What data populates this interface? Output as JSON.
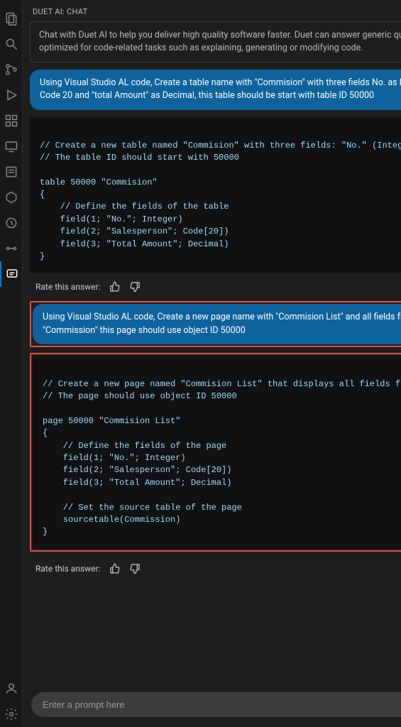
{
  "header": {
    "title": "DUET AI: CHAT"
  },
  "intro": "Chat with Duet AI to help you deliver high quality software faster. Duet can answer generic questions, but it's optimized for code-related tasks such as explaining, generating or modifying code.",
  "messages": {
    "user1": "Using Visual Studio AL code, Create a table name with \"Commision\" with three fields No. as Integer, Salesperson as Code 20 and \"total Amount\" as Decimal, this table should be start with table ID 50000",
    "code1": "// Create a new table named \"Commision\" with three fields: \"No.\" (Integer), \"Salesperson\"\n// The table ID should start with 50000\n\ntable 50000 \"Commision\"\n{\n    // Define the fields of the table\n    field(1; \"No.\"; Integer)\n    field(2; \"Salesperson\"; Code[20])\n    field(3; \"Total Amount\"; Decimal)\n}",
    "user2": "Using Visual Studio AL code, Create a new page name with \"Commision List\" and all fields from the table \"Commission\" this page should use object ID 50000",
    "code2": "// Create a new page named \"Commision List\" that displays all fields from the \"Commision\"\n// The page should use object ID 50000\n\npage 50000 \"Commision List\"\n{\n    // Define the fields of the page\n    field(1; \"No.\"; Integer)\n    field(2; \"Salesperson\"; Code[20])\n    field(3; \"Total Amount\"; Decimal)\n\n    // Set the source table of the page\n    sourcetable(Commission)\n}"
  },
  "rate_label": "Rate this answer:",
  "input": {
    "placeholder": "Enter a prompt here"
  }
}
